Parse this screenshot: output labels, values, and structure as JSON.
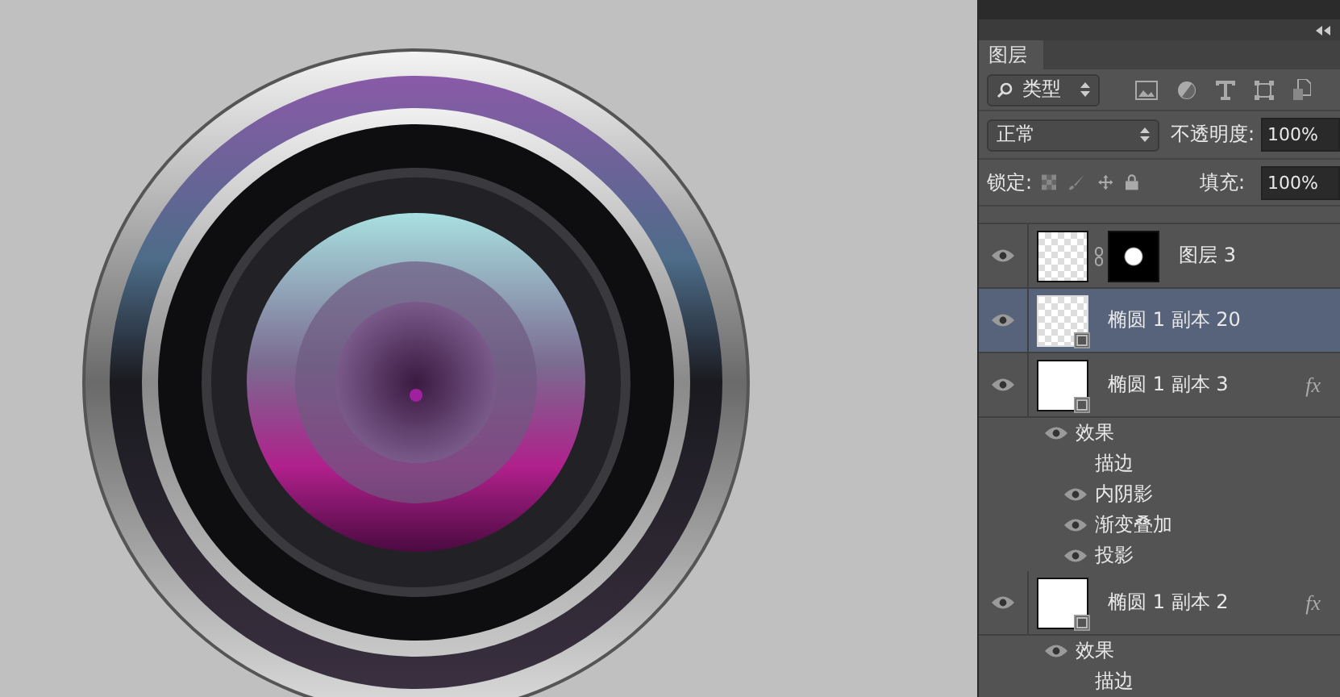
{
  "panel": {
    "tab": {
      "label": "图层"
    },
    "filter": {
      "value": "类型"
    },
    "blend_mode": {
      "value": "正常"
    },
    "opacity": {
      "label": "不透明度:",
      "value": "100%"
    },
    "lock": {
      "label": "锁定:"
    },
    "fill": {
      "label": "填充:",
      "value": "100%"
    },
    "layers": [
      {
        "name": "图层 3",
        "visible": true,
        "selected": false,
        "kind": "pixel",
        "thumbnail_filled": false,
        "mask": true
      },
      {
        "name": "椭圆 1 副本 20",
        "visible": true,
        "selected": true,
        "kind": "shape",
        "thumbnail_filled": false,
        "mask": false
      },
      {
        "name": "椭圆 1 副本 3",
        "visible": true,
        "selected": false,
        "kind": "shape",
        "thumbnail_filled": true,
        "mask": false,
        "fx_badge": "fx",
        "effects": {
          "label": "效果",
          "visible": true,
          "items": [
            {
              "name": "描边",
              "visible": false
            },
            {
              "name": "内阴影",
              "visible": true
            },
            {
              "name": "渐变叠加",
              "visible": true
            },
            {
              "name": "投影",
              "visible": true
            }
          ]
        }
      },
      {
        "name": "椭圆 1 副本 2",
        "visible": true,
        "selected": false,
        "kind": "shape",
        "thumbnail_filled": true,
        "mask": false,
        "fx_badge": "fx",
        "effects": {
          "label": "效果",
          "visible": true,
          "items": [
            {
              "name": "描边",
              "visible": false
            }
          ]
        }
      }
    ]
  }
}
